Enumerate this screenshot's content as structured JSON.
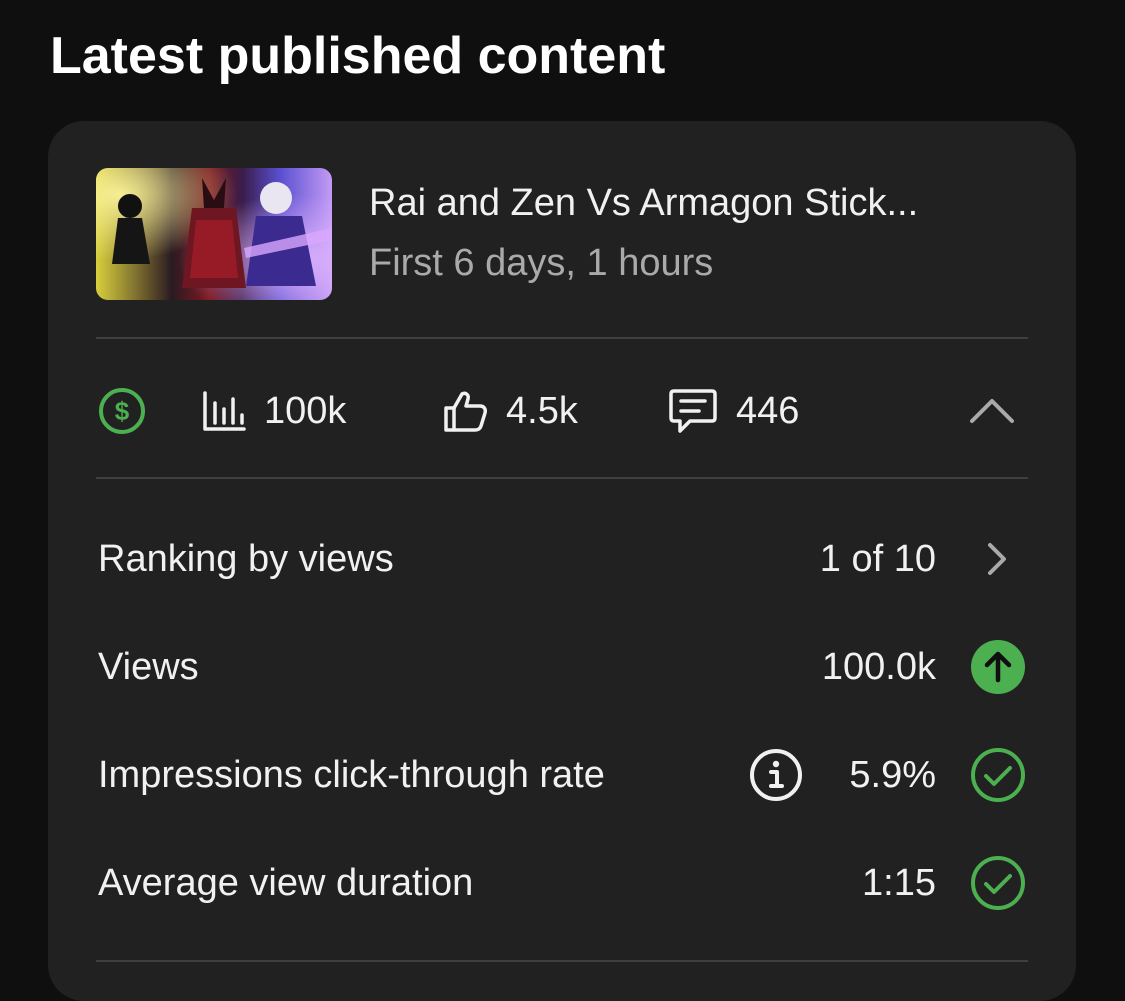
{
  "section": {
    "title": "Latest published content"
  },
  "video": {
    "title": "Rai and Zen Vs Armagon Stick...",
    "subtitle": "First 6 days, 1 hours",
    "thumbnail_icon": "video-thumbnail"
  },
  "stats": {
    "monetization_icon": "dollar-circle-icon",
    "views": "100k",
    "likes": "4.5k",
    "comments": "446",
    "collapse_icon": "chevron-up-icon"
  },
  "metrics": [
    {
      "label": "Ranking by views",
      "value": "1 of 10",
      "status_icon": "chevron-right-icon"
    },
    {
      "label": "Views",
      "value": "100.0k",
      "status_icon": "arrow-up-circle-icon"
    },
    {
      "label": "Impressions click-through rate",
      "value": "5.9%",
      "status_icon": "check-circle-icon",
      "info_icon": "info-icon"
    },
    {
      "label": "Average view duration",
      "value": "1:15",
      "status_icon": "check-circle-icon"
    }
  ],
  "colors": {
    "page_background": "#0f0f0f",
    "card_background": "#212121",
    "accent_green": "#4caf50",
    "text_primary": "#f1f1f1",
    "text_secondary": "#aaaaaa"
  }
}
